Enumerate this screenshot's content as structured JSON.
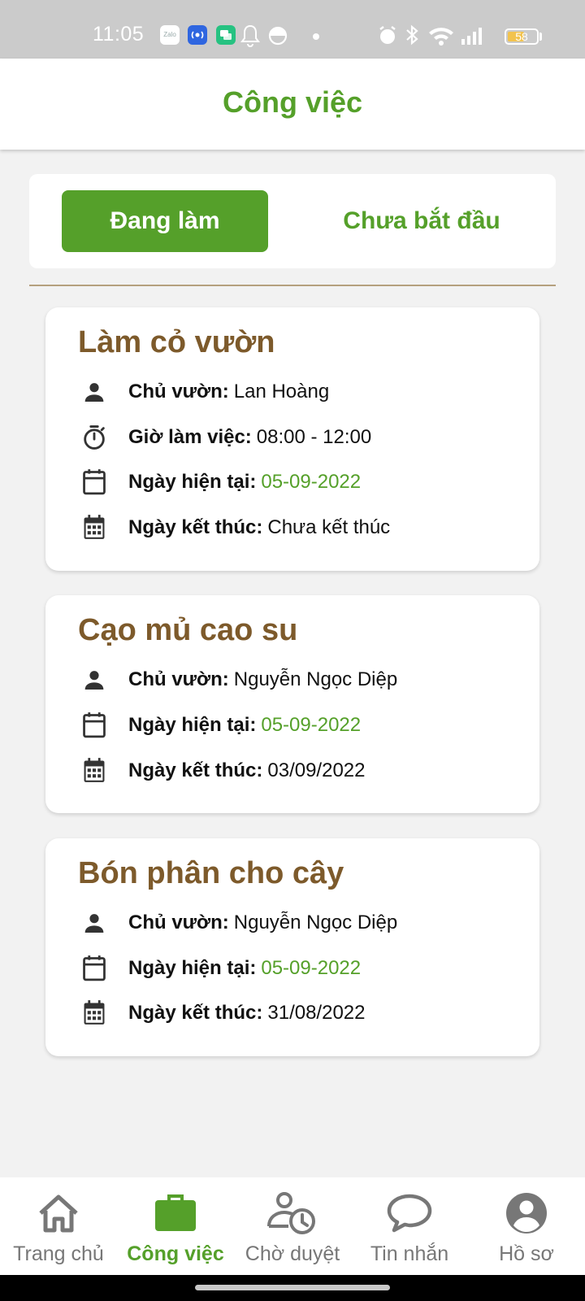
{
  "status_bar": {
    "time": "11:05",
    "app_icons": [
      "zalo-icon",
      "broadcast-app-icon",
      "chat-app-icon",
      "bell-off-icon",
      "dnd-icon"
    ],
    "system_icons": [
      "alarm-icon",
      "bluetooth-icon",
      "wifi-icon",
      "signal-icon"
    ],
    "battery_level": "58",
    "zalo_label": "Zalo"
  },
  "header": {
    "title": "Công việc"
  },
  "tabs": [
    {
      "label": "Đang làm",
      "active": true
    },
    {
      "label": "Chưa bắt đầu",
      "active": false
    }
  ],
  "tasks": [
    {
      "title": "Làm cỏ vườn",
      "owner_label": "Chủ vườn:",
      "owner": "Lan Hoàng",
      "hours_label": "Giờ làm việc:",
      "hours": "08:00 - 12:00",
      "current_label": "Ngày hiện tại:",
      "current_date": "05-09-2022",
      "end_label": "Ngày kết thúc:",
      "end_date": "Chưa kết thúc"
    },
    {
      "title": "Cạo mủ cao su",
      "owner_label": "Chủ vườn:",
      "owner": "Nguyễn Ngọc Diệp",
      "current_label": "Ngày hiện tại:",
      "current_date": "05-09-2022",
      "end_label": "Ngày kết thúc:",
      "end_date": "03/09/2022"
    },
    {
      "title": "Bón phân cho cây",
      "owner_label": "Chủ vườn:",
      "owner": "Nguyễn Ngọc Diệp",
      "current_label": "Ngày hiện tại:",
      "current_date": "05-09-2022",
      "end_label": "Ngày kết thúc:",
      "end_date": "31/08/2022"
    }
  ],
  "nav": [
    {
      "label": "Trang chủ",
      "icon": "home-icon",
      "active": false
    },
    {
      "label": "Công việc",
      "icon": "briefcase-icon",
      "active": true
    },
    {
      "label": "Chờ duyệt",
      "icon": "user-clock-icon",
      "active": false
    },
    {
      "label": "Tin nhắn",
      "icon": "chat-bubble-icon",
      "active": false
    },
    {
      "label": "Hồ sơ",
      "icon": "account-circle-icon",
      "active": false
    }
  ],
  "colors": {
    "primary": "#55a02a",
    "title_brown": "#7d5a2b",
    "background": "#f2f2f2"
  }
}
